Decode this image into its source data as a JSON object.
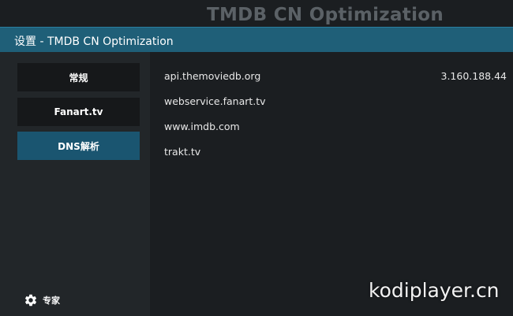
{
  "background_title": "TMDB CN Optimization",
  "header": {
    "title": "设置 - TMDB CN Optimization"
  },
  "sidebar": {
    "categories": [
      {
        "label": "常规",
        "active": false
      },
      {
        "label": "Fanart.tv",
        "active": false
      },
      {
        "label": "DNS解析",
        "active": true
      }
    ],
    "expert": {
      "label": "专家",
      "icon": "gear-icon"
    }
  },
  "settings": {
    "rows": [
      {
        "label": "api.themoviedb.org",
        "value": "3.160.188.44"
      },
      {
        "label": "webservice.fanart.tv",
        "value": ""
      },
      {
        "label": "www.imdb.com",
        "value": ""
      },
      {
        "label": "trakt.tv",
        "value": ""
      }
    ]
  },
  "watermark": "kodiplayer.cn",
  "colors": {
    "accent": "#1f5f78",
    "active_button": "#1a5570",
    "background": "#1b1e21"
  }
}
